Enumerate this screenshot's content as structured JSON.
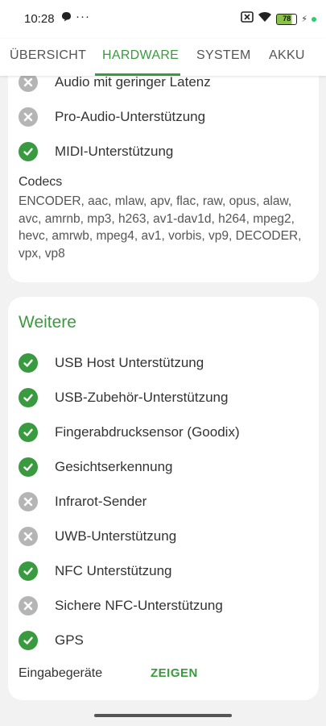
{
  "status_bar": {
    "time": "10:28",
    "notification_glyph": "●",
    "more_dots": "···",
    "battery_level": "78",
    "icons": [
      "notification-icon",
      "sim-off-icon",
      "wifi-icon",
      "battery-icon",
      "charging-icon"
    ]
  },
  "tabs": [
    {
      "label": "ÜBERSICHT",
      "active": false
    },
    {
      "label": "HARDWARE",
      "active": true
    },
    {
      "label": "SYSTEM",
      "active": false
    },
    {
      "label": "AKKU",
      "active": false
    }
  ],
  "card1": {
    "features": [
      {
        "label": "Audio mit geringer Latenz",
        "supported": false
      },
      {
        "label": "Pro-Audio-Unterstützung",
        "supported": false
      },
      {
        "label": "MIDI-Unterstützung",
        "supported": true
      }
    ],
    "codecs_title": "Codecs",
    "codecs": "ENCODER, aac, mlaw, apv, flac, raw, opus, alaw, avc, amrnb, mp3, h263, av1-dav1d, h264, mpeg2, hevc, amrwb, mpeg4, av1, vorbis, vp9, DECODER, vpx, vp8"
  },
  "card2": {
    "title": "Weitere",
    "features": [
      {
        "label": "USB Host Unterstützung",
        "supported": true
      },
      {
        "label": "USB-Zubehör-Unterstützung",
        "supported": true
      },
      {
        "label": "Fingerabdrucksensor (Goodix)",
        "supported": true
      },
      {
        "label": "Gesichtserkennung",
        "supported": true
      },
      {
        "label": "Infrarot-Sender",
        "supported": false
      },
      {
        "label": "UWB-Unterstützung",
        "supported": false
      },
      {
        "label": "NFC Unterstützung",
        "supported": true
      },
      {
        "label": "Sichere NFC-Unterstützung",
        "supported": false
      },
      {
        "label": "GPS",
        "supported": true
      }
    ],
    "input_devices_label": "Eingabegeräte",
    "show_button": "ZEIGEN"
  },
  "colors": {
    "accent": "#3a9a3f",
    "unsupported": "#b5b5b5",
    "background": "#f2f2f2"
  }
}
